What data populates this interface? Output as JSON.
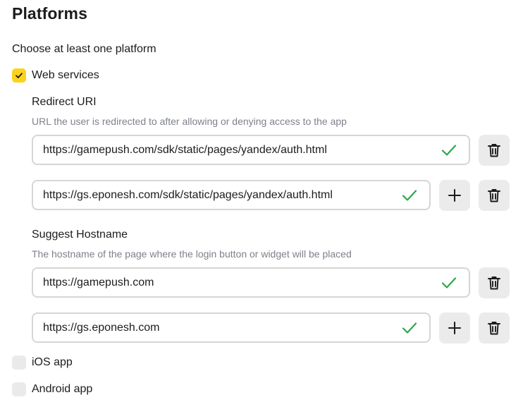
{
  "page": {
    "title": "Platforms",
    "subtitle": "Choose at least one platform"
  },
  "platforms": {
    "web": {
      "label": "Web services",
      "checked": true
    },
    "ios": {
      "label": "iOS app",
      "checked": false
    },
    "android": {
      "label": "Android app",
      "checked": false
    }
  },
  "redirect": {
    "label": "Redirect URI",
    "hint": "URL the user is redirected to after allowing or denying access to the app",
    "values": [
      "https://gamepush.com/sdk/static/pages/yandex/auth.html",
      "https://gs.eponesh.com/sdk/static/pages/yandex/auth.html"
    ]
  },
  "hostname": {
    "label": "Suggest Hostname",
    "hint": "The hostname of the page where the login button or widget will be placed",
    "values": [
      "https://gamepush.com",
      "https://gs.eponesh.com"
    ]
  },
  "icons": {
    "valid": "check-icon",
    "add": "plus-icon",
    "delete": "trash-icon",
    "checkbox_checked": "checkmark-icon"
  },
  "colors": {
    "accent_checkbox": "#fcd21d",
    "valid_check": "#2aa84a",
    "button_bg": "#ebebeb",
    "hint_text": "#7d818a"
  }
}
